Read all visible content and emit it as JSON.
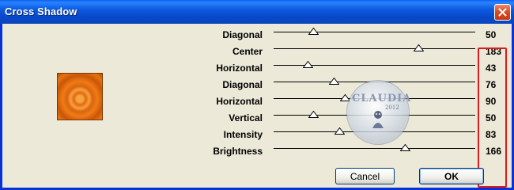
{
  "window": {
    "title": "Cross Shadow"
  },
  "sliders": [
    {
      "label": "Diagonal",
      "value": "50",
      "level": 50
    },
    {
      "label": "Center",
      "value": "183",
      "level": 183
    },
    {
      "label": "Horizontal",
      "value": "43",
      "level": 43
    },
    {
      "label": "Diagonal",
      "value": "76",
      "level": 76
    },
    {
      "label": "Horizontal",
      "value": "90",
      "level": 90
    },
    {
      "label": "Vertical",
      "value": "50",
      "level": 50
    },
    {
      "label": "Intensity",
      "value": "83",
      "level": 83
    },
    {
      "label": "Brightness",
      "value": "166",
      "level": 166
    }
  ],
  "slider_max": 255,
  "buttons": {
    "cancel": "Cancel",
    "ok": "OK"
  },
  "watermark": {
    "text": "CLAUDIA",
    "sub": "2012"
  },
  "colors": {
    "titlebar": "#0a5ae0",
    "highlight_box": "#e01a1a",
    "preview": "#f07b15"
  }
}
